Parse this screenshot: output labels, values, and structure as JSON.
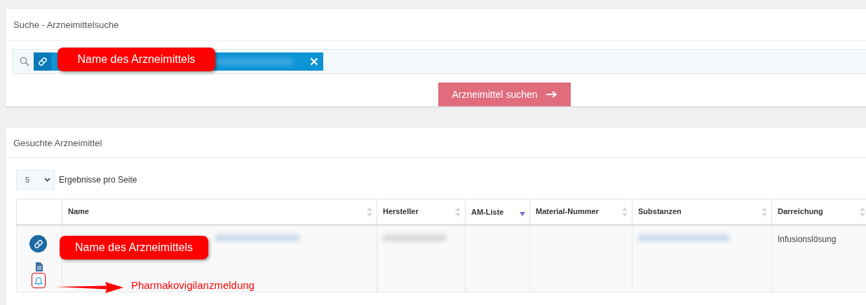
{
  "search_panel": {
    "title": "Suche - Arzneimittelsuche",
    "chip": {
      "redacted": true,
      "callout": "Name des Arzneimittels"
    },
    "button": "Arzneimittel suchen"
  },
  "results_panel": {
    "title": "Gesuchte Arzneimittel",
    "page_size": "5",
    "page_size_label": "Ergebnisse pro Seite",
    "table": {
      "columns": [
        {
          "label": "Name",
          "sorted": false
        },
        {
          "label": "Hersteller",
          "sorted": false
        },
        {
          "label": "AM-Liste",
          "sorted": true
        },
        {
          "label": "Material-Nummer",
          "sorted": false
        },
        {
          "label": "Substanzen",
          "sorted": false
        },
        {
          "label": "Darreichung",
          "sorted": false
        }
      ],
      "rows": [
        {
          "callout": "Name des Arzneimittels",
          "actions": [
            {
              "kind": "pill"
            },
            {
              "kind": "document"
            },
            {
              "kind": "bell",
              "highlighted": true,
              "callout": "Pharmakovigilanzmeldung"
            }
          ],
          "cells": [
            {
              "redacted": true
            },
            {
              "redacted": true
            },
            {},
            {},
            {
              "redacted": true
            },
            {
              "text": "Infusionslösung"
            }
          ]
        }
      ]
    }
  }
}
